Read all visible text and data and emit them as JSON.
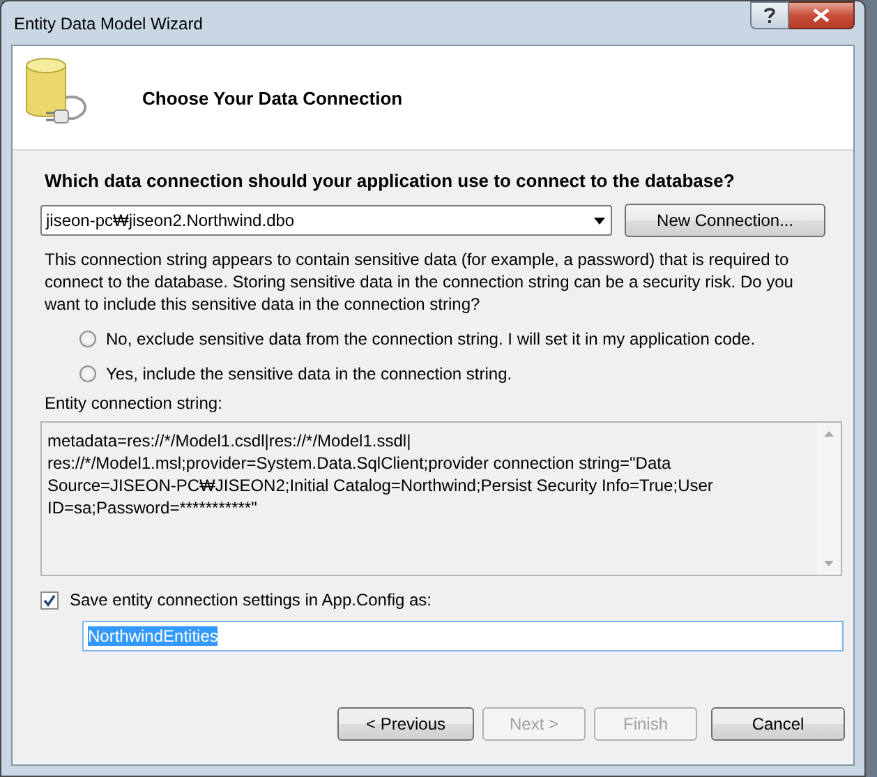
{
  "window": {
    "title": "Entity Data Model Wizard"
  },
  "header": {
    "title": "Choose Your Data Connection"
  },
  "connection": {
    "question": "Which data connection should your application use to connect to the database?",
    "selected_connection": "jiseon-pc₩jiseon2.Northwind.dbo",
    "new_connection_button": "New Connection..."
  },
  "sensitive_data": {
    "description": "This connection string appears to contain sensitive data (for example, a password) that is required to connect to the database. Storing sensitive data in the connection string can be a security risk. Do you want to include this sensitive data in the connection string?",
    "options": [
      {
        "label": "No, exclude sensitive data from the connection string. I will set it in my application code.",
        "selected": false
      },
      {
        "label": "Yes, include the sensitive data in the connection string.",
        "selected": false
      }
    ]
  },
  "entity_connection_string": {
    "label": "Entity connection string:",
    "lines": [
      "metadata=res://*/Model1.csdl|res://*/Model1.ssdl|",
      "res://*/Model1.msl;provider=System.Data.SqlClient;provider connection string=\"Data",
      "Source=JISEON-PC₩JISEON2;Initial Catalog=Northwind;Persist Security Info=True;User",
      "ID=sa;Password=***********\""
    ]
  },
  "save_settings": {
    "label": "Save entity connection settings in App.Config as:",
    "checked": true,
    "value": "NorthwindEntities",
    "value_highlighted": true
  },
  "buttons": [
    {
      "label": "< Previous",
      "disabled": false
    },
    {
      "label": "Next >",
      "disabled": true
    },
    {
      "label": "Finish",
      "disabled": true
    },
    {
      "label": "Cancel",
      "disabled": false
    }
  ]
}
